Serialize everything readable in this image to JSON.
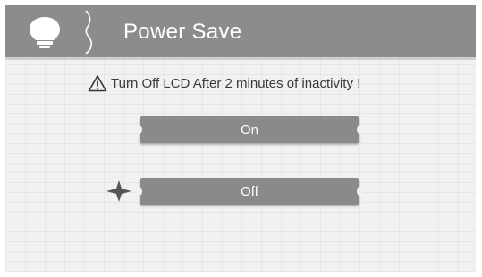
{
  "header": {
    "title": "Power Save",
    "icon": "lightbulb-icon",
    "background_color": "#8c8c8c"
  },
  "warning": {
    "icon": "warning-triangle-icon",
    "text": "Turn Off LCD After 2 minutes of inactivity !"
  },
  "options": [
    {
      "label": "On",
      "selected": false
    },
    {
      "label": "Off",
      "selected": true
    }
  ],
  "selector_icon": "four-point-star-icon",
  "colors": {
    "button": "#8a8a8a",
    "button_text": "#ffffff",
    "background": "#f1f1f1"
  }
}
